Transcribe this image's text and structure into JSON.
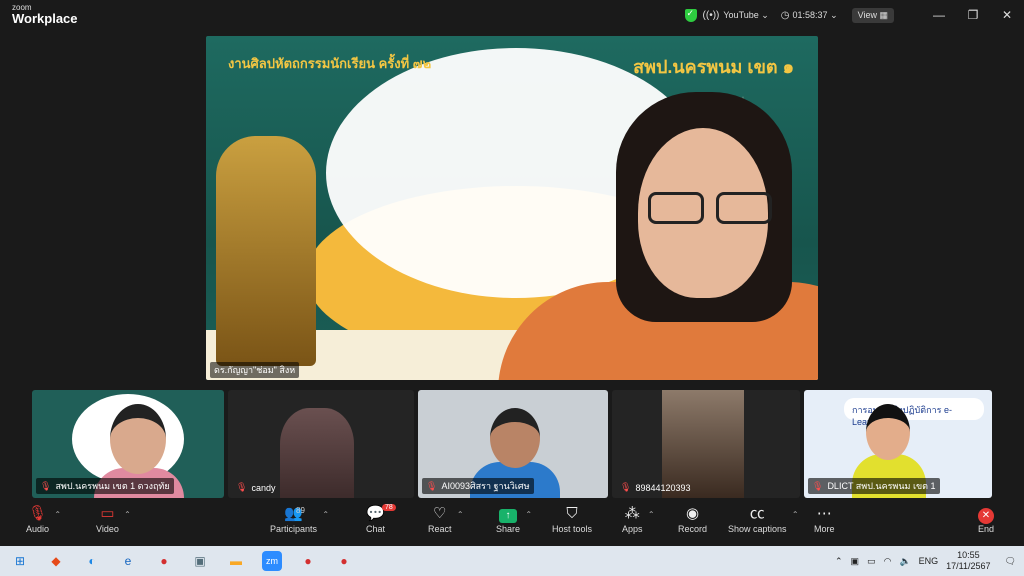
{
  "app": {
    "brand_top": "zoom",
    "brand_bottom": "Workplace"
  },
  "titlebar": {
    "stream_label": "YouTube ⌄",
    "timer": "01:58:37 ⌄",
    "view_label": "View",
    "minimize": "—",
    "restore": "❐",
    "close": "✕"
  },
  "stage": {
    "banner_left": "งานศิลปหัตถกรรมนักเรียน ครั้งที่ ๗๒",
    "banner_right": "สพป.นครพนม เขต ๑",
    "speaker_name": "ดร.กัญญา\"ช่อม\" สิงห"
  },
  "participants": [
    {
      "name": "สพป.นครพนม เขต 1 ดวงฤทัย",
      "muted": true
    },
    {
      "name": "candy",
      "muted": true
    },
    {
      "name": "AI0093ศิสรา ฐานวิเศษ",
      "muted": true
    },
    {
      "name": "89844120393",
      "muted": true
    },
    {
      "name": "DLICT สพป.นครพนม เขต 1",
      "muted": true
    }
  ],
  "tile5_banner": "การอบรมเชิงปฏิบัติการ e-Learning",
  "controls": {
    "audio": "Audio",
    "video": "Video",
    "participants": "Participants",
    "participants_count": "89",
    "chat": "Chat",
    "chat_badge": "78",
    "react": "React",
    "share": "Share",
    "host_tools": "Host tools",
    "apps": "Apps",
    "record": "Record",
    "captions": "Show captions",
    "more": "More",
    "end": "End"
  },
  "taskbar": {
    "language": "ENG",
    "time": "10:55",
    "date": "17/11/2567"
  },
  "colors": {
    "accent": "#18b26a",
    "end": "#e53935",
    "stage_bg": "#1e6a60"
  }
}
